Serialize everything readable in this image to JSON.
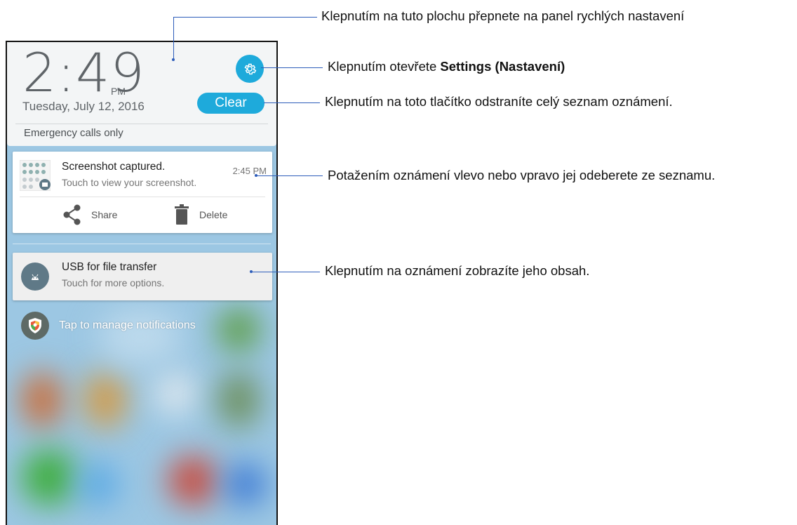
{
  "phone": {
    "time_hm": "2:49",
    "ampm": "PM",
    "date": "Tuesday, July 12, 2016",
    "clear_label": "Clear",
    "emergency": "Emergency calls only",
    "settings_icon": "gear-icon",
    "notifications": [
      {
        "title": "Screenshot captured.",
        "subtitle": "Touch to view your screenshot.",
        "time": "2:45 PM",
        "actions": [
          {
            "label": "Share",
            "icon": "share-icon"
          },
          {
            "label": "Delete",
            "icon": "trash-icon"
          }
        ]
      },
      {
        "title": "USB for file transfer",
        "subtitle": "Touch for more options.",
        "icon": "android-icon"
      }
    ],
    "manage_label": "Tap to manage notifications"
  },
  "callouts": {
    "quick_settings": "Klepnutím na tuto plochu přepnete na panel rychlých nastavení",
    "settings_prefix": "Klepnutím otevřete ",
    "settings_bold": "Settings (Nastavení)",
    "clear": "Klepnutím na toto tlačítko odstraníte celý seznam oznámení.",
    "swipe": "Potažením oznámení vlevo nebo vpravo jej odeberete ze seznamu.",
    "tap": "Klepnutím na oznámení zobrazíte jeho obsah."
  },
  "colors": {
    "accent": "#1eaadb",
    "callout_line": "#2d5dba"
  }
}
